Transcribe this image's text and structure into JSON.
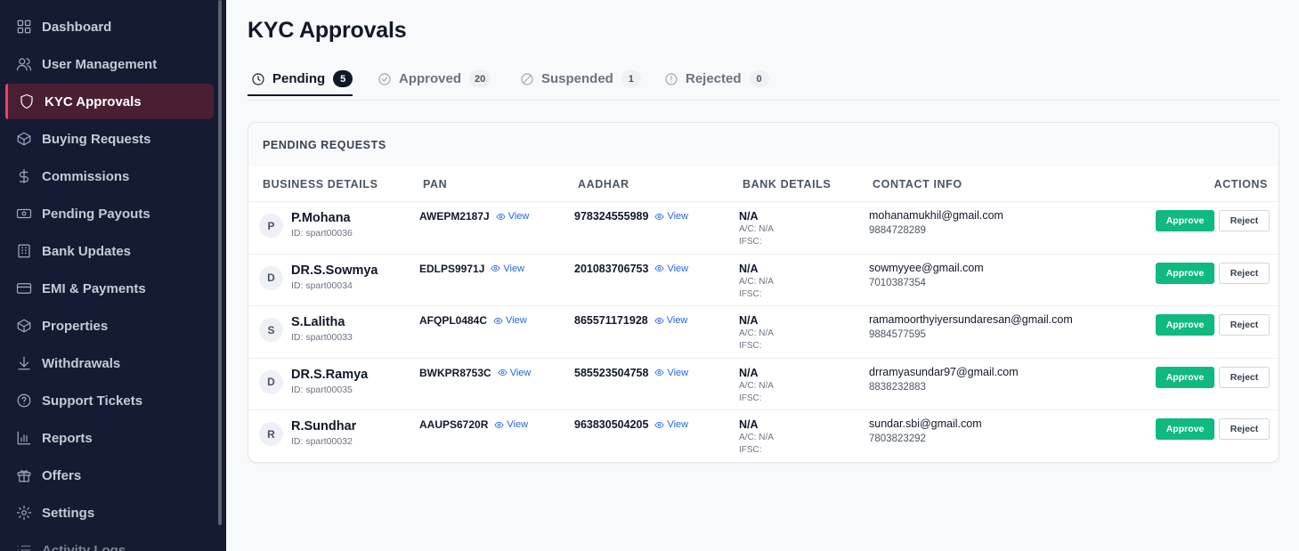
{
  "sidebar": {
    "items": [
      {
        "label": "Dashboard",
        "icon": "grid-icon"
      },
      {
        "label": "User Management",
        "icon": "users-icon"
      },
      {
        "label": "KYC Approvals",
        "icon": "shield-icon",
        "active": true
      },
      {
        "label": "Buying Requests",
        "icon": "box-icon"
      },
      {
        "label": "Commissions",
        "icon": "dollar-icon"
      },
      {
        "label": "Pending Payouts",
        "icon": "banknote-icon"
      },
      {
        "label": "Bank Updates",
        "icon": "bank-icon"
      },
      {
        "label": "EMI & Payments",
        "icon": "credit-card-icon"
      },
      {
        "label": "Properties",
        "icon": "box-icon"
      },
      {
        "label": "Withdrawals",
        "icon": "download-icon"
      },
      {
        "label": "Support Tickets",
        "icon": "help-circle-icon"
      },
      {
        "label": "Reports",
        "icon": "bar-chart-icon"
      },
      {
        "label": "Offers",
        "icon": "gift-icon"
      },
      {
        "label": "Settings",
        "icon": "gear-icon"
      },
      {
        "label": "Activity Logs",
        "icon": "list-icon"
      }
    ]
  },
  "header": {
    "title": "KYC Approvals"
  },
  "tabs": [
    {
      "label": "Pending",
      "count": "5",
      "icon": "clock-icon",
      "active": true
    },
    {
      "label": "Approved",
      "count": "20",
      "icon": "check-circle-icon"
    },
    {
      "label": "Suspended",
      "count": "1",
      "icon": "ban-icon"
    },
    {
      "label": "Rejected",
      "count": "0",
      "icon": "alert-circle-icon"
    }
  ],
  "table": {
    "title": "PENDING REQUESTS",
    "columns": [
      "BUSINESS DETAILS",
      "PAN",
      "AADHAR",
      "BANK DETAILS",
      "CONTACT INFO",
      "ACTIONS"
    ],
    "view_label": "View",
    "approve_label": "Approve",
    "reject_label": "Reject",
    "rows": [
      {
        "initial": "P",
        "name": "P.Mohana",
        "id": "ID: spart00036",
        "pan": "AWEPM2187J",
        "aadhar": "978324555989",
        "bank": "N/A",
        "ac": "A/C: N/A",
        "ifsc": "IFSC:",
        "email": "mohanamukhil@gmail.com",
        "phone": "9884728289"
      },
      {
        "initial": "D",
        "name": "DR.S.Sowmya",
        "id": "ID: spart00034",
        "pan": "EDLPS9971J",
        "aadhar": "201083706753",
        "bank": "N/A",
        "ac": "A/C: N/A",
        "ifsc": "IFSC:",
        "email": "sowmyyee@gmail.com",
        "phone": "7010387354"
      },
      {
        "initial": "S",
        "name": "S.Lalitha",
        "id": "ID: spart00033",
        "pan": "AFQPL0484C",
        "aadhar": "865571171928",
        "bank": "N/A",
        "ac": "A/C: N/A",
        "ifsc": "IFSC:",
        "email": "ramamoorthyiyersundaresan@gmail.com",
        "phone": "9884577595"
      },
      {
        "initial": "D",
        "name": "DR.S.Ramya",
        "id": "ID: spart00035",
        "pan": "BWKPR8753C",
        "aadhar": "585523504758",
        "bank": "N/A",
        "ac": "A/C: N/A",
        "ifsc": "IFSC:",
        "email": "drramyasundar97@gmail.com",
        "phone": "8838232883"
      },
      {
        "initial": "R",
        "name": "R.Sundhar",
        "id": "ID: spart00032",
        "pan": "AAUPS6720R",
        "aadhar": "963830504205",
        "bank": "N/A",
        "ac": "A/C: N/A",
        "ifsc": "IFSC:",
        "email": "sundar.sbi@gmail.com",
        "phone": "7803823292"
      }
    ]
  },
  "colors": {
    "sidebar_bg": "#141b33",
    "active_item_bg": "#4a1f34",
    "active_accent": "#f43f5e",
    "approve_green": "#10b981",
    "link_blue": "#2563eb"
  }
}
